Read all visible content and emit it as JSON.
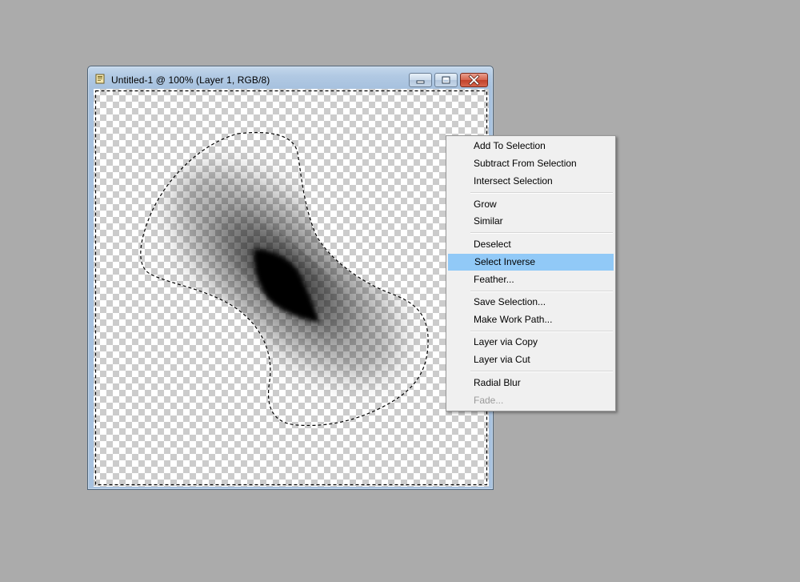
{
  "window": {
    "title": "Untitled-1 @ 100% (Layer 1, RGB/8)",
    "icon": "photoshop-document-icon",
    "controls": {
      "minimize_icon": "minimize-icon",
      "restore_icon": "restore-icon",
      "close_icon": "close-icon"
    }
  },
  "canvas": {
    "background": "transparency-checkerboard",
    "content": "blurred-black-shape-with-marching-ants-selection"
  },
  "context_menu": {
    "groups": [
      [
        {
          "label": "Add To Selection",
          "enabled": true
        },
        {
          "label": "Subtract From Selection",
          "enabled": true
        },
        {
          "label": "Intersect Selection",
          "enabled": true
        }
      ],
      [
        {
          "label": "Grow",
          "enabled": true
        },
        {
          "label": "Similar",
          "enabled": true
        }
      ],
      [
        {
          "label": "Deselect",
          "enabled": true
        },
        {
          "label": "Select Inverse",
          "enabled": true,
          "highlighted": true
        },
        {
          "label": "Feather...",
          "enabled": true
        }
      ],
      [
        {
          "label": "Save Selection...",
          "enabled": true
        },
        {
          "label": "Make Work Path...",
          "enabled": true
        }
      ],
      [
        {
          "label": "Layer via Copy",
          "enabled": true
        },
        {
          "label": "Layer via Cut",
          "enabled": true
        }
      ],
      [
        {
          "label": "Radial Blur",
          "enabled": true
        },
        {
          "label": "Fade...",
          "enabled": false
        }
      ]
    ]
  },
  "colors": {
    "workspace": "#ababab",
    "highlight": "#91c9f7",
    "disabled_text": "#9a9a9a"
  }
}
